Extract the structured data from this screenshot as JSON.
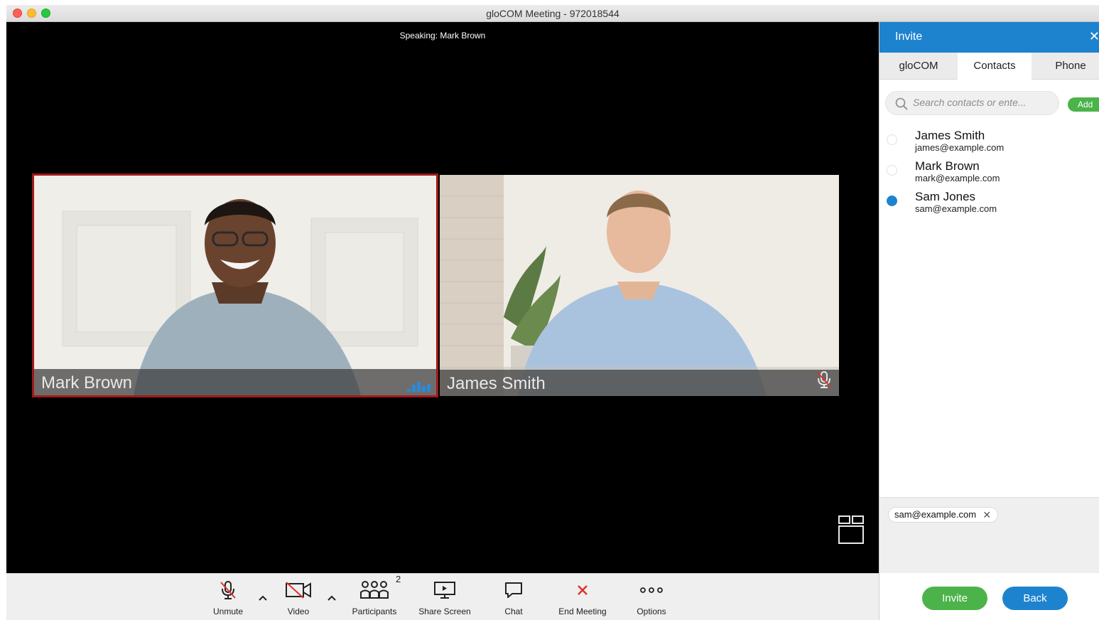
{
  "window": {
    "title": "gloCOM Meeting - 972018544"
  },
  "stage": {
    "speaking": "Speaking: Mark Brown"
  },
  "tiles": [
    {
      "name": "Mark Brown",
      "active_speaker": true
    },
    {
      "name": "James Smith",
      "muted": true
    }
  ],
  "toolbar": {
    "unmute": "Unmute",
    "video": "Video",
    "participants": "Participants",
    "participants_count": "2",
    "share_screen": "Share Screen",
    "chat": "Chat",
    "end_meeting": "End Meeting",
    "options": "Options"
  },
  "panel": {
    "title": "Invite",
    "close": "✕",
    "tabs": [
      "gloCOM",
      "Contacts",
      "Phone"
    ],
    "search_placeholder": "Search contacts or ente...",
    "add_label": "Add",
    "contacts": [
      {
        "name": "James Smith",
        "email": "james@example.com",
        "selected": false
      },
      {
        "name": "Mark Brown",
        "email": "mark@example.com",
        "selected": false
      },
      {
        "name": "Sam Jones",
        "email": "sam@example.com",
        "selected": true
      }
    ],
    "chip": "sam@example.com",
    "chip_remove": "✕",
    "invite": "Invite",
    "back": "Back"
  },
  "colors": {
    "accent": "#1e83cf",
    "success": "#4cb34a",
    "danger": "#e0322a",
    "speaker_border": "#a11919"
  }
}
